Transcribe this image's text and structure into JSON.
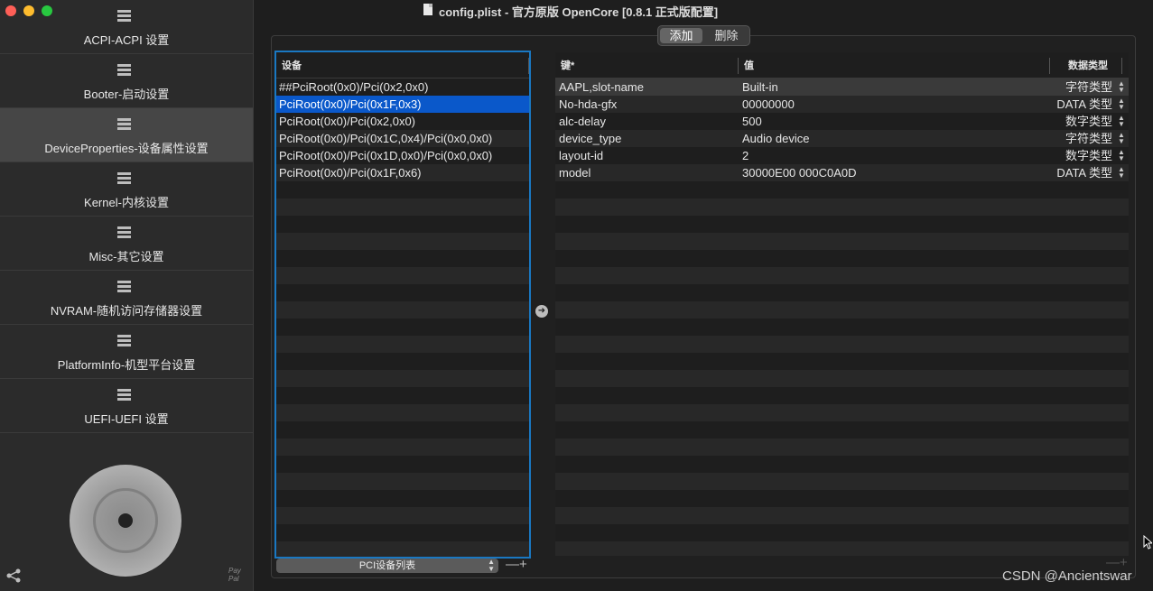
{
  "window": {
    "title": "config.plist - 官方原版 OpenCore [0.8.1 正式版配置]"
  },
  "sidebar": {
    "items": [
      {
        "label": "ACPI-ACPI 设置",
        "active": false
      },
      {
        "label": "Booter-启动设置",
        "active": false
      },
      {
        "label": "DeviceProperties-设备属性设置",
        "active": true
      },
      {
        "label": "Kernel-内核设置",
        "active": false
      },
      {
        "label": "Misc-其它设置",
        "active": false
      },
      {
        "label": "NVRAM-随机访问存储器设置",
        "active": false
      },
      {
        "label": "PlatformInfo-机型平台设置",
        "active": false
      },
      {
        "label": "UEFI-UEFI 设置",
        "active": false
      }
    ],
    "paypal_text": "Pay Pal"
  },
  "toolbar": {
    "add_label": "添加",
    "delete_label": "删除"
  },
  "devices": {
    "header": "设备",
    "rows": [
      "##PciRoot(0x0)/Pci(0x2,0x0)",
      "PciRoot(0x0)/Pci(0x1F,0x3)",
      "PciRoot(0x0)/Pci(0x2,0x0)",
      "PciRoot(0x0)/Pci(0x1C,0x4)/Pci(0x0,0x0)",
      "PciRoot(0x0)/Pci(0x1D,0x0)/Pci(0x0,0x0)",
      "PciRoot(0x0)/Pci(0x1F,0x6)"
    ],
    "selected_index": 1,
    "select_label": "PCI设备列表"
  },
  "properties": {
    "headers": {
      "key": "键*",
      "value": "值",
      "type": "数据类型"
    },
    "rows": [
      {
        "key": "AAPL,slot-name",
        "value": "Built-in",
        "type": "字符类型"
      },
      {
        "key": "No-hda-gfx",
        "value": "00000000",
        "type": "DATA 类型"
      },
      {
        "key": "alc-delay",
        "value": "500",
        "type": "数字类型"
      },
      {
        "key": "device_type",
        "value": "Audio device",
        "type": "字符类型"
      },
      {
        "key": "layout-id",
        "value": "2",
        "type": "数字类型"
      },
      {
        "key": "model",
        "value": "30000E00 000C0A0D",
        "type": "DATA 类型"
      }
    ]
  },
  "controls": {
    "minus_plus": "—+",
    "arrow_icon": "arrow-right-circle-icon"
  },
  "watermark": "CSDN @Ancientswar",
  "colors": {
    "selection": "#0a58ca",
    "focus_border": "#1a78c2",
    "background": "#1e1e1e",
    "sidebar": "#2b2b2b"
  }
}
